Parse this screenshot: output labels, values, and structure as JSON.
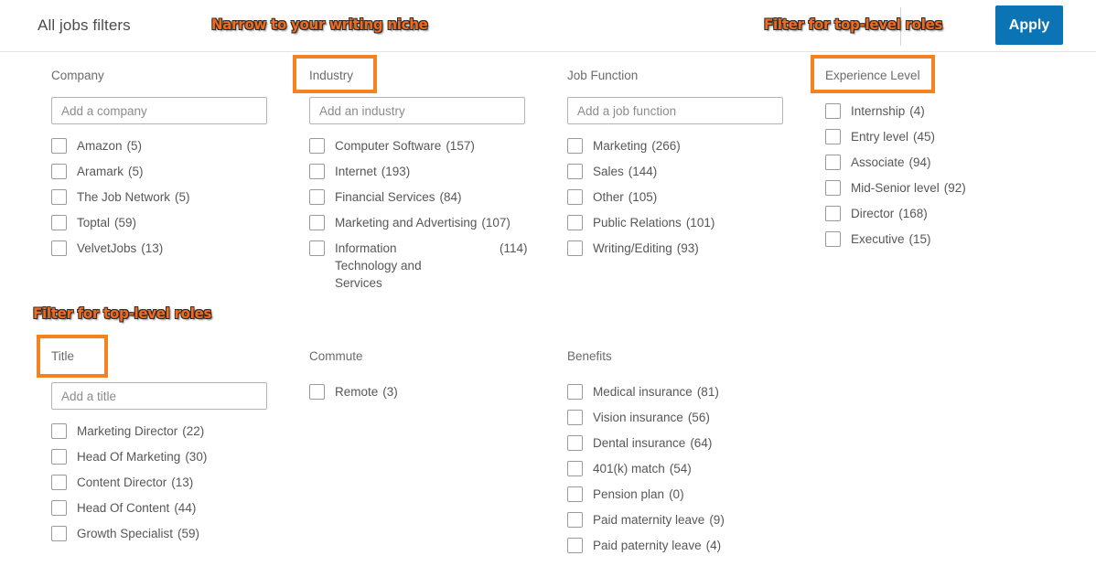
{
  "header": {
    "title": "All jobs filters",
    "apply_label": "Apply"
  },
  "annotations": [
    {
      "text": "Narrow to your writing niche",
      "color": "#F26A1B"
    },
    {
      "text": "Filter for top-level roles",
      "color": "#F26A1B"
    },
    {
      "text": "Filter for top-level roles",
      "color": "#F26A1B"
    }
  ],
  "highlight_color": "#F58220",
  "accent_color": "#0a74b4",
  "columns": {
    "company": {
      "label": "Company",
      "placeholder": "Add a company",
      "options": [
        {
          "label": "Amazon",
          "count": "(5)"
        },
        {
          "label": "Aramark",
          "count": "(5)"
        },
        {
          "label": "The Job Network",
          "count": "(5)"
        },
        {
          "label": "Toptal",
          "count": "(59)"
        },
        {
          "label": "VelvetJobs",
          "count": "(13)"
        }
      ]
    },
    "industry": {
      "label": "Industry",
      "placeholder": "Add an industry",
      "options": [
        {
          "label": "Computer Software",
          "count": "(157)"
        },
        {
          "label": "Internet",
          "count": "(193)"
        },
        {
          "label": "Financial Services",
          "count": "(84)"
        },
        {
          "label": "Marketing and Advertising",
          "count": "(107)"
        },
        {
          "label": "Information Technology and Services",
          "count": "(114)"
        }
      ]
    },
    "job_function": {
      "label": "Job Function",
      "placeholder": "Add a job function",
      "options": [
        {
          "label": "Marketing",
          "count": "(266)"
        },
        {
          "label": "Sales",
          "count": "(144)"
        },
        {
          "label": "Other",
          "count": "(105)"
        },
        {
          "label": "Public Relations",
          "count": "(101)"
        },
        {
          "label": "Writing/Editing",
          "count": "(93)"
        }
      ]
    },
    "experience_level": {
      "label": "Experience Level",
      "options": [
        {
          "label": "Internship",
          "count": "(4)"
        },
        {
          "label": "Entry level",
          "count": "(45)"
        },
        {
          "label": "Associate",
          "count": "(94)"
        },
        {
          "label": "Mid-Senior level",
          "count": "(92)"
        },
        {
          "label": "Director",
          "count": "(168)"
        },
        {
          "label": "Executive",
          "count": "(15)"
        }
      ]
    },
    "title": {
      "label": "Title",
      "placeholder": "Add a title",
      "options": [
        {
          "label": "Marketing Director",
          "count": "(22)"
        },
        {
          "label": "Head Of Marketing",
          "count": "(30)"
        },
        {
          "label": "Content Director",
          "count": "(13)"
        },
        {
          "label": "Head Of Content",
          "count": "(44)"
        },
        {
          "label": "Growth Specialist",
          "count": "(59)"
        }
      ]
    },
    "commute": {
      "label": "Commute",
      "options": [
        {
          "label": "Remote",
          "count": "(3)"
        }
      ]
    },
    "benefits": {
      "label": "Benefits",
      "options": [
        {
          "label": "Medical insurance",
          "count": "(81)"
        },
        {
          "label": "Vision insurance",
          "count": "(56)"
        },
        {
          "label": "Dental insurance",
          "count": "(64)"
        },
        {
          "label": "401(k) match",
          "count": "(54)"
        },
        {
          "label": "Pension plan",
          "count": "(0)"
        },
        {
          "label": "Paid maternity leave",
          "count": "(9)"
        },
        {
          "label": "Paid paternity leave",
          "count": "(4)"
        }
      ]
    }
  }
}
